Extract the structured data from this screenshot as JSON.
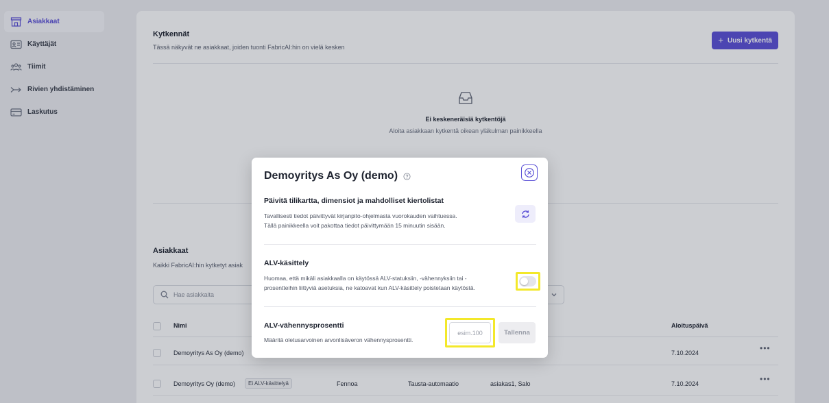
{
  "sidebar": {
    "items": [
      {
        "label": "Asiakkaat",
        "icon": "store-icon",
        "active": true
      },
      {
        "label": "Käyttäjät",
        "icon": "id-card-icon",
        "active": false
      },
      {
        "label": "Tiimit",
        "icon": "team-icon",
        "active": false
      },
      {
        "label": "Rivien yhdistäminen",
        "icon": "merge-arrow-icon",
        "active": false
      },
      {
        "label": "Laskutus",
        "icon": "credit-card-icon",
        "active": false
      }
    ]
  },
  "connections": {
    "title": "Kytkennät",
    "subtitle": "Tässä näkyvät ne asiakkaat, joiden tuonti FabricAI:hin on vielä kesken",
    "new_button": "Uusi kytkentä",
    "empty_title": "Ei keskeneräisiä kytkentöjä",
    "empty_subtitle": "Aloita asiakkaan kytkentä oikean yläkulman painikkeella"
  },
  "customers": {
    "title": "Asiakkaat",
    "subtitle": "Kaikki FabricAI:hin kytketyt asiak",
    "search_placeholder": "Hae asiakkaita",
    "columns": {
      "name": "Nimi",
      "start_date": "Aloituspäivä"
    },
    "rows": [
      {
        "name": "Demoyritys As Oy (demo)",
        "badge": "",
        "system": "",
        "automation": "",
        "people": "",
        "start_date": "7.10.2024"
      },
      {
        "name": "Demoyritys Oy (demo)",
        "badge": "Ei ALV-käsittelyä",
        "system": "Fennoa",
        "automation": "Tausta-automaatio",
        "people": "asiakas1, Salo",
        "start_date": "7.10.2024"
      }
    ]
  },
  "modal": {
    "title": "Demoyritys As Oy (demo)",
    "refresh": {
      "title": "Päivitä tilikartta, dimensiot ja mahdolliset kiertolistat",
      "desc_line1": "Tavallisesti tiedot päivittyvät kirjanpito-ohjelmasta vuorokauden vaihtuessa.",
      "desc_line2": "Tällä painikkeella voit pakottaa tiedot päivittymään 15 minuutin sisään."
    },
    "vat": {
      "title": "ALV-käsittely",
      "desc_line1": "Huomaa, että mikäli asiakkaalla on käytössä ALV-statuksiin, -vähennyksiin tai -",
      "desc_line2": "prosentteihin liittyviä asetuksia, ne katoavat kun ALV-käsittely poistetaan käytöstä.",
      "enabled": false
    },
    "vat_pct": {
      "title": "ALV-vähennysprosentti",
      "desc": "Määritä oletusarvoinen arvonlisäveron vähennysprosentti.",
      "value": "",
      "placeholder": "esim.100",
      "save_label": "Tallenna"
    }
  },
  "colors": {
    "accent": "#5b50d6",
    "highlight": "#f3e82a"
  }
}
